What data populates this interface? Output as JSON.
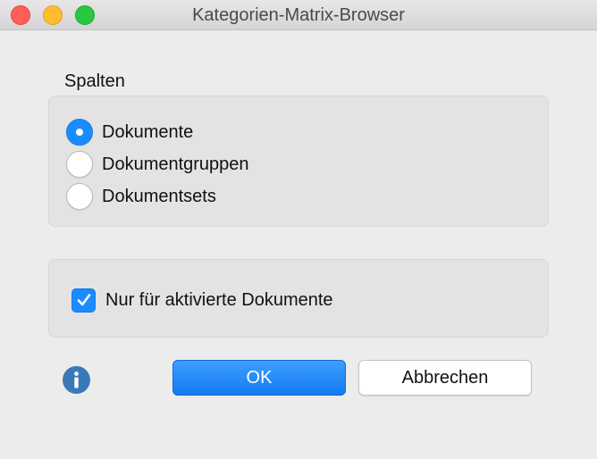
{
  "window": {
    "title": "Kategorien-Matrix-Browser"
  },
  "columns": {
    "label": "Spalten",
    "options": [
      {
        "label": "Dokumente",
        "checked": true
      },
      {
        "label": "Dokumentgruppen",
        "checked": false
      },
      {
        "label": "Dokumentsets",
        "checked": false
      }
    ]
  },
  "options": {
    "only_activated_label": "Nur für aktivierte Dokumente",
    "only_activated_checked": true
  },
  "buttons": {
    "ok_label": "OK",
    "cancel_label": "Abbrechen"
  },
  "colors": {
    "accent": "#1a8cff",
    "close": "#fe5f57",
    "minimize": "#febc2e",
    "zoom": "#28c840",
    "info": "#3a79b8"
  },
  "icons": {
    "info": "info-icon",
    "check": "checkmark-icon"
  }
}
